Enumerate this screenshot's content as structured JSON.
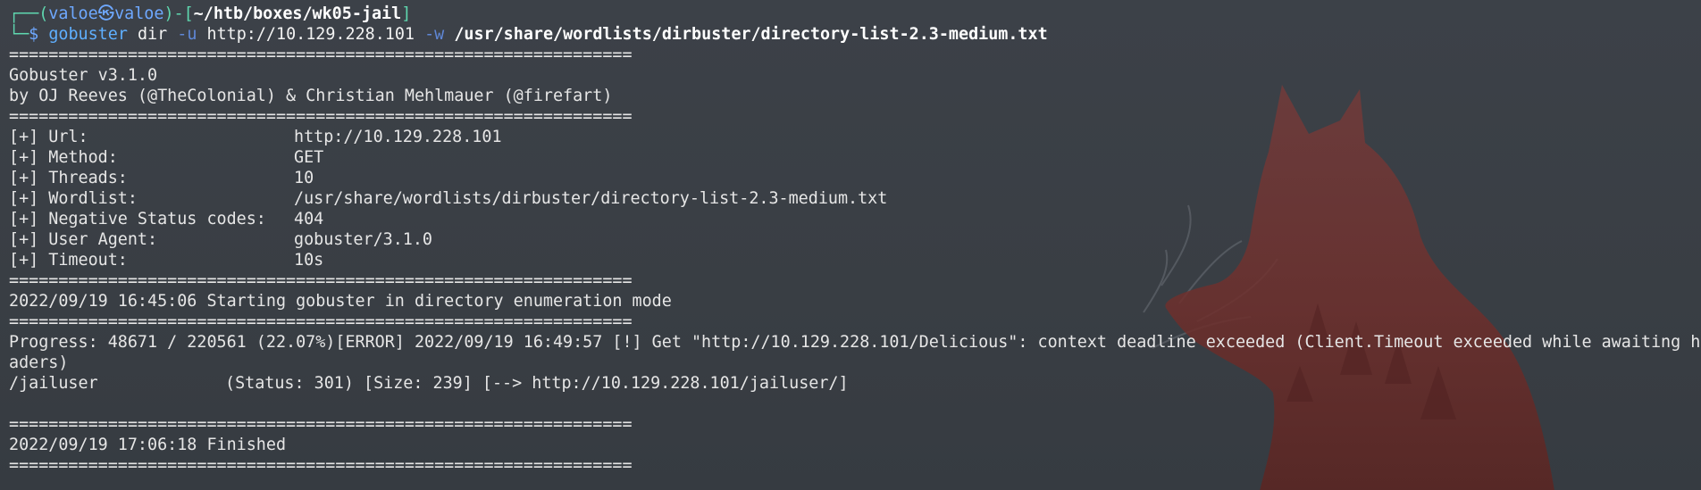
{
  "prompt": {
    "box_top": "┌──(",
    "user": "valoe",
    "at_symbol": "㉿",
    "host": "valoe",
    "sep": ")-[",
    "path": "~/htb/boxes/wk05-jail",
    "close": "]",
    "box_bottom": "└─",
    "dollar": "$ "
  },
  "command": {
    "name": "gobuster",
    "sub": " dir ",
    "flag_u": "-u",
    "url": " http://10.129.228.101 ",
    "flag_w": "-w",
    "wordlist": " /usr/share/wordlists/dirbuster/directory-list-2.3-medium.txt"
  },
  "output": {
    "rule": "===============================================================",
    "version": "Gobuster v3.1.0",
    "authors": "by OJ Reeves (@TheColonial) & Christian Mehlmauer (@firefart)",
    "params": [
      {
        "label": "[+] Url:",
        "value": "http://10.129.228.101"
      },
      {
        "label": "[+] Method:",
        "value": "GET"
      },
      {
        "label": "[+] Threads:",
        "value": "10"
      },
      {
        "label": "[+] Wordlist:",
        "value": "/usr/share/wordlists/dirbuster/directory-list-2.3-medium.txt"
      },
      {
        "label": "[+] Negative Status codes:",
        "value": "404"
      },
      {
        "label": "[+] User Agent:",
        "value": "gobuster/3.1.0"
      },
      {
        "label": "[+] Timeout:",
        "value": "10s"
      }
    ],
    "start": "2022/09/19 16:45:06 Starting gobuster in directory enumeration mode",
    "progress_line_1": "Progress: 48671 / 220561 (22.07%)[ERROR] 2022/09/19 16:49:57 [!] Get \"http://10.129.228.101/Delicious\": context deadline exceeded (Client.Timeout exceeded while awaiting he",
    "progress_line_2": "aders)",
    "result": {
      "path": "/jailuser",
      "status": "(Status: 301)",
      "rest": "[Size: 239] [--> http://10.129.228.101/jailuser/]"
    },
    "finished": "2022/09/19 17:06:18 Finished"
  },
  "colors": {
    "background": "#3a3f45",
    "prompt_green": "#5fd7af",
    "prompt_blue": "#6ea8ff",
    "command_blue": "#5fafff",
    "text": "#e6e6e6",
    "wallpaper_fox": "#8a3a36"
  },
  "wallpaper": {
    "icon": "fox-silhouette-icon"
  }
}
